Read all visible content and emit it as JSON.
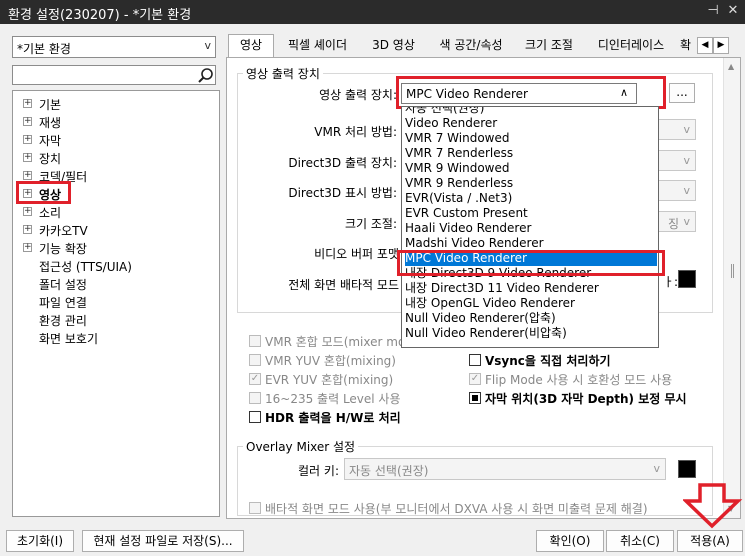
{
  "window": {
    "title": "환경 설정(230207) - *기본 환경",
    "pin_glyph": "⊣",
    "close_glyph": "✕"
  },
  "profile": {
    "value": "*기본 환경"
  },
  "tree": {
    "items": [
      {
        "label": "기본",
        "expandable": true
      },
      {
        "label": "재생",
        "expandable": true
      },
      {
        "label": "자막",
        "expandable": true
      },
      {
        "label": "장치",
        "expandable": true
      },
      {
        "label": "코덱/필터",
        "expandable": true
      },
      {
        "label": "영상",
        "expandable": true,
        "selected": true
      },
      {
        "label": "소리",
        "expandable": true
      },
      {
        "label": "카카오TV",
        "expandable": true
      },
      {
        "label": "기능 확장",
        "expandable": true
      },
      {
        "label": "접근성 (TTS/UIA)",
        "expandable": false
      },
      {
        "label": "폴더 설정",
        "expandable": false
      },
      {
        "label": "파일 연결",
        "expandable": false
      },
      {
        "label": "환경 관리",
        "expandable": false
      },
      {
        "label": "화면 보호기",
        "expandable": false
      }
    ]
  },
  "tabs": [
    "영상",
    "픽셀 셰이더",
    "3D 영상",
    "색 공간/속성",
    "크기 조절",
    "디인터레이스",
    "확"
  ],
  "output_group": {
    "legend": "영상 출력 장치",
    "device_label": "영상 출력 장치:",
    "device_value": "MPC Video Renderer",
    "browse_label": "...",
    "rows": [
      {
        "label": "VMR 처리 방법:"
      },
      {
        "label": "Direct3D 출력 장치:"
      },
      {
        "label": "Direct3D 표시 방법:"
      },
      {
        "label": "크기 조절:",
        "value_fragment": "징"
      },
      {
        "label": "비디오 버퍼 포맷"
      },
      {
        "label": "전체 화면 배타적 모드"
      }
    ],
    "colon_fragment": "ㅏ:"
  },
  "renderer_dropdown": {
    "items": [
      "자동 선택(권장)",
      "Video Renderer",
      "VMR 7 Windowed",
      "VMR 7 Renderless",
      "VMR 9 Windowed",
      "VMR 9 Renderless",
      "EVR(Vista / .Net3)",
      "EVR Custom Present",
      "Haali Video Renderer",
      "Madshi Video Renderer",
      "MPC Video Renderer",
      "내장 Direct3D 9 Video Renderer",
      "내장 Direct3D 11 Video Renderer",
      "내장 OpenGL Video Renderer",
      "Null Video Renderer(압축)",
      "Null Video Renderer(비압축)"
    ],
    "selected_index": 10
  },
  "options": {
    "left": [
      {
        "label": "VMR 혼합 모드(mixer mo",
        "checked": false,
        "enabled": false
      },
      {
        "label": "VMR YUV 혼합(mixing)",
        "checked": false,
        "enabled": false
      },
      {
        "label": "EVR YUV 혼합(mixing)",
        "checked": true,
        "enabled": false
      },
      {
        "label": "16~235 출력 Level 사용",
        "checked": false,
        "enabled": false
      },
      {
        "label": "HDR 출력을 H/W로 처리",
        "checked": false,
        "enabled": true
      }
    ],
    "right": [
      {
        "label": "Vsync을 직접 처리하기",
        "checked": false,
        "enabled": true
      },
      {
        "label": "Flip Mode 사용 시 호환성 모드 사용",
        "checked": true,
        "enabled": false
      },
      {
        "label": "자막 위치(3D 자막 Depth) 보정 무시",
        "checked": false,
        "enabled": true,
        "filled": true
      }
    ]
  },
  "overlay_group": {
    "legend": "Overlay Mixer 설정",
    "color_key_label": "컬러 키:",
    "color_key_value": "자동 선택(권장)",
    "exclusive_label": "배타적 화면 모드 사용(부 모니터에서 DXVA 사용 시 화면 미출력 문제 해결)"
  },
  "footer": {
    "reset": "초기화(I)",
    "save_to_file": "현재 설정 파일로 저장(S)...",
    "ok": "확인(O)",
    "cancel": "취소(C)",
    "apply": "적용(A)"
  },
  "colors": {
    "highlight": "#e0202a",
    "selection": "#0078d7",
    "titlebar": "#2b2b2b"
  }
}
